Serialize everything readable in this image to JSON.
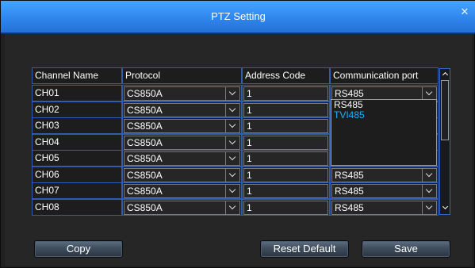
{
  "window": {
    "title": "PTZ Setting",
    "close_glyph": "✕"
  },
  "table": {
    "headers": [
      "Channel Name",
      "Protocol",
      "Address Code",
      "Communication port"
    ],
    "rows": [
      {
        "channel": "CH01",
        "protocol": "CS850A",
        "address": "1",
        "port": "RS485"
      },
      {
        "channel": "CH02",
        "protocol": "CS850A",
        "address": "1",
        "port": ""
      },
      {
        "channel": "CH03",
        "protocol": "CS850A",
        "address": "1",
        "port": ""
      },
      {
        "channel": "CH04",
        "protocol": "CS850A",
        "address": "1",
        "port": ""
      },
      {
        "channel": "CH05",
        "protocol": "CS850A",
        "address": "1",
        "port": ""
      },
      {
        "channel": "CH06",
        "protocol": "CS850A",
        "address": "1",
        "port": "RS485"
      },
      {
        "channel": "CH07",
        "protocol": "CS850A",
        "address": "1",
        "port": "RS485"
      },
      {
        "channel": "CH08",
        "protocol": "CS850A",
        "address": "1",
        "port": "RS485"
      }
    ]
  },
  "port_dropdown": {
    "options": [
      "RS485",
      "TVI485"
    ],
    "highlighted": "TVI485"
  },
  "buttons": {
    "copy": "Copy",
    "reset": "Reset Default",
    "save": "Save"
  },
  "colors": {
    "titlebar": "#2f86ec",
    "grid_border": "#2f5bb0",
    "highlight_text": "#1db1ff"
  }
}
